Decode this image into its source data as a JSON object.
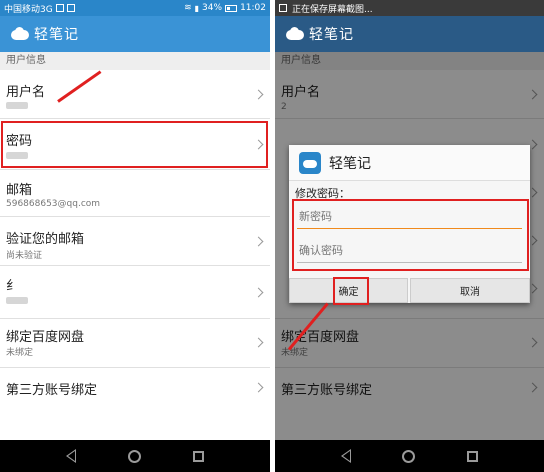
{
  "left": {
    "status_bar": {
      "carrier": "中国移动3G",
      "battery": "34%",
      "time": "11:02"
    },
    "app_title": "轻笔记",
    "section_header": "用户信息",
    "items": [
      {
        "title": "用户名",
        "sub": ""
      },
      {
        "title": "密码",
        "sub": ""
      },
      {
        "title": "邮箱",
        "sub": "596868653@qq.com"
      },
      {
        "title": "验证您的邮箱",
        "sub": "尚未验证"
      },
      {
        "title": "纟",
        "sub": ""
      },
      {
        "title": "绑定百度网盘",
        "sub": "未绑定"
      },
      {
        "title": "第三方账号绑定",
        "sub": ""
      }
    ]
  },
  "right": {
    "status_bar": {
      "notification": "正在保存屏幕截图..."
    },
    "app_title": "轻笔记",
    "section_header": "用户信息",
    "items": [
      {
        "title": "用户名",
        "sub": "2"
      },
      {
        "title": "绑定百度网盘",
        "sub": "未绑定"
      },
      {
        "title": "第三方账号绑定",
        "sub": ""
      }
    ],
    "dialog": {
      "title": "轻笔记",
      "label": "修改密码：",
      "new_password_placeholder": "新密码",
      "confirm_password_placeholder": "确认密码",
      "confirm_label": "确定",
      "cancel_label": "取消"
    }
  },
  "colors": {
    "status_bar": "#2a86c9",
    "app_bar": "#3a93d6",
    "highlight": "#e02020",
    "input_accent": "#f08a1c"
  }
}
